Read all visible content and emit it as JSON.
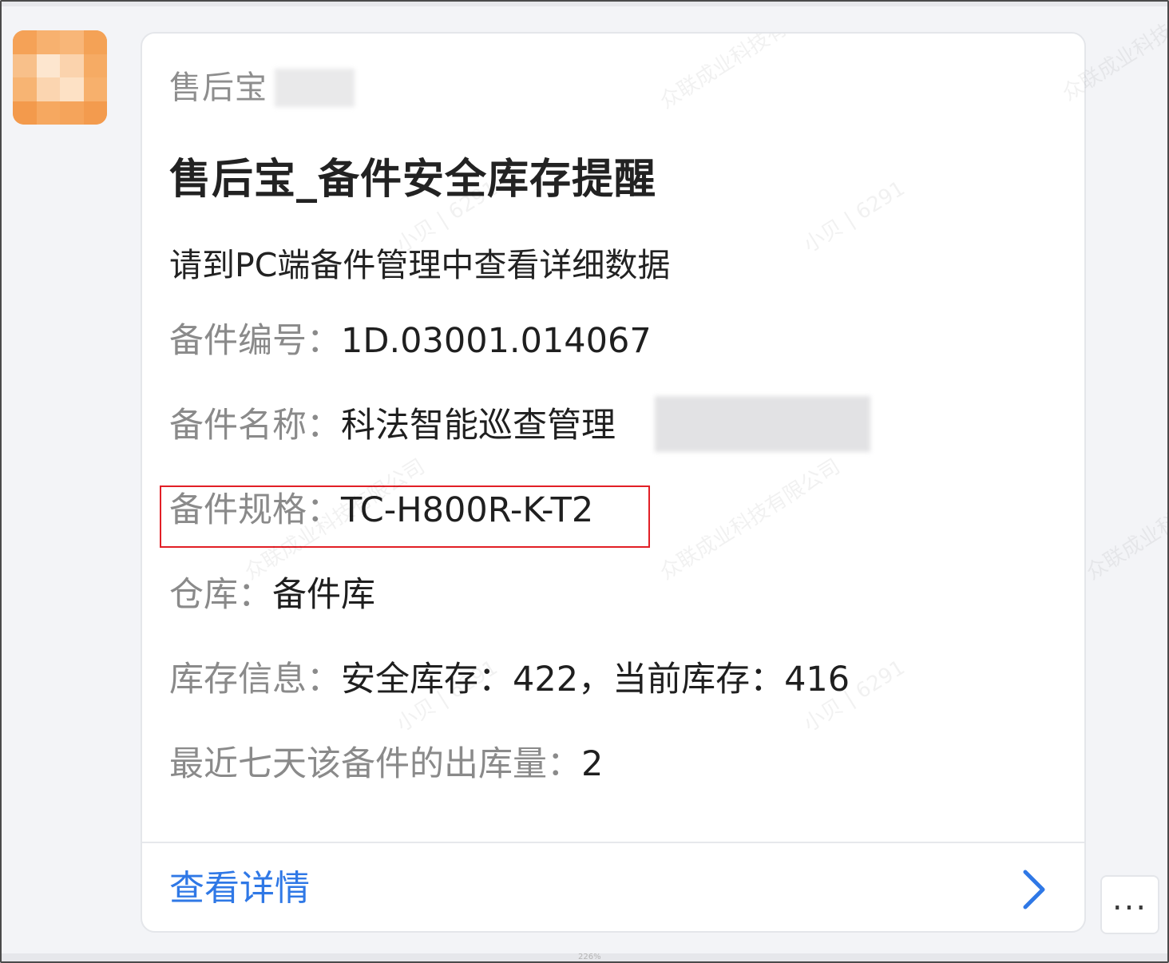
{
  "sender": {
    "name": "售后宝"
  },
  "card": {
    "title": "售后宝_备件安全库存提醒",
    "subtitle": "请到PC端备件管理中查看详细数据",
    "fields": [
      {
        "label": "备件编号：",
        "value": "1D.03001.014067"
      },
      {
        "label": "备件名称：",
        "value": "科法智能巡查管理"
      },
      {
        "label": "备件规格：",
        "value": "TC-H800R-K-T2"
      },
      {
        "label": "仓库：",
        "value": "备件库"
      },
      {
        "label": "库存信息：",
        "value": "安全库存：422，当前库存：416"
      },
      {
        "label": "最近七天该备件的出库量：",
        "value": "2"
      }
    ],
    "footer": {
      "link_label": "查看详情"
    }
  },
  "more_button": {
    "label": "..."
  },
  "watermark": {
    "company": "众联成业科技有限公司",
    "user": "小贝 | 6291"
  },
  "zoom": "226%",
  "colors": {
    "link": "#2f78e6",
    "highlight": "#e21f26",
    "avatar": "#f6a65e"
  }
}
